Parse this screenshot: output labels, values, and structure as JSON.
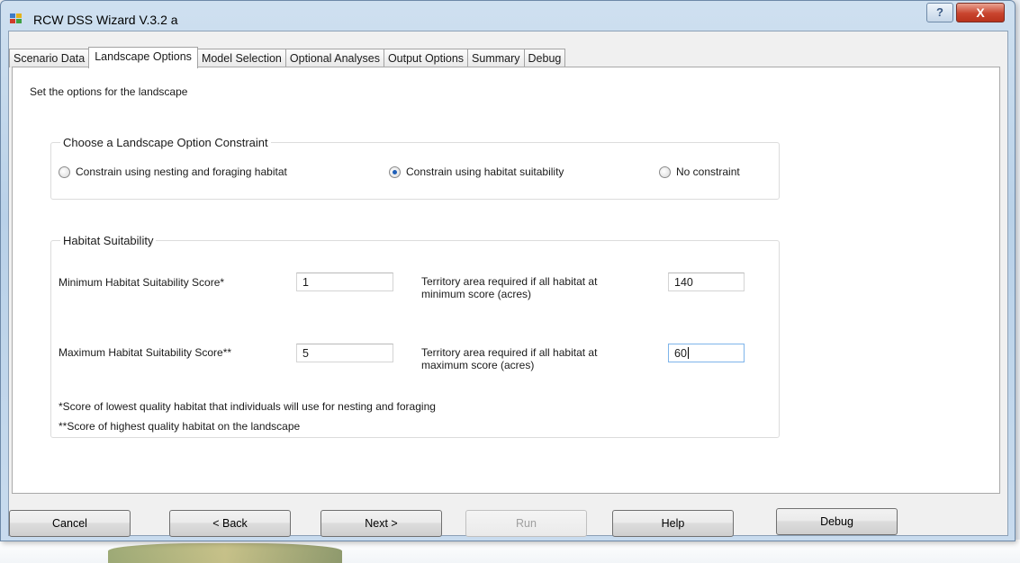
{
  "window": {
    "title": "RCW DSS Wizard V.3.2 a",
    "help_glyph": "?",
    "close_glyph": "X"
  },
  "tabs": [
    {
      "label": "Scenario Data",
      "active": false
    },
    {
      "label": "Landscape Options",
      "active": true
    },
    {
      "label": "Model Selection",
      "active": false
    },
    {
      "label": "Optional Analyses",
      "active": false
    },
    {
      "label": "Output Options",
      "active": false
    },
    {
      "label": "Summary",
      "active": false
    },
    {
      "label": "Debug",
      "active": false
    }
  ],
  "page": {
    "intro": "Set the options for the landscape",
    "constraint_group": {
      "title": "Choose a Landscape Option Constraint",
      "options": [
        {
          "label": "Constrain using nesting and foraging habitat",
          "checked": false
        },
        {
          "label": "Constrain using habitat suitability",
          "checked": true
        },
        {
          "label": "No constraint",
          "checked": false
        }
      ]
    },
    "habitat_group": {
      "title": "Habitat Suitability",
      "min_label": "Minimum Habitat Suitability Score*",
      "min_value": "1",
      "max_label": "Maximum Habitat Suitability Score**",
      "max_value": "5",
      "territory_min_label_1": "Territory area required if all habitat at",
      "territory_min_label_2": "minimum score (acres)",
      "territory_min_value": "140",
      "territory_max_label_1": "Territory area required if all habitat at",
      "territory_max_label_2": "maximum score (acres)",
      "territory_max_value": "60",
      "footnote_1": "*Score of lowest quality habitat that individuals will use for nesting and foraging",
      "footnote_2": "**Score of highest quality habitat on the landscape"
    }
  },
  "buttons": {
    "cancel": "Cancel",
    "back": "< Back",
    "next": "Next >",
    "run": "Run",
    "help": "Help",
    "debug": "Debug"
  }
}
